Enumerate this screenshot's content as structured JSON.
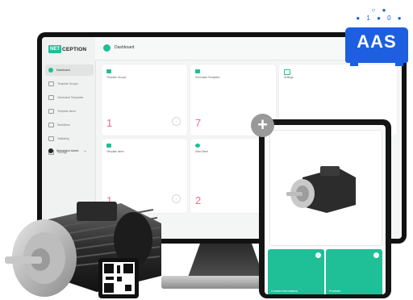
{
  "app": {
    "logo_mark": "NET",
    "logo_text": "CEPTION",
    "page_title": "Dashboard"
  },
  "sidebar": {
    "items": [
      {
        "label": "Dashboard",
        "active": true
      },
      {
        "label": "Template Groups",
        "active": false
      },
      {
        "label": "Generated Templates",
        "active": false
      },
      {
        "label": "Template Items",
        "active": false
      },
      {
        "label": "Workflows",
        "active": false
      },
      {
        "label": "Validating",
        "active": false
      },
      {
        "label": "Settings",
        "active": false
      }
    ],
    "user_name": "Nexception Admin"
  },
  "cards": [
    {
      "title": "Template Groups",
      "value": "1"
    },
    {
      "title": "Generated Templates",
      "value": "7"
    },
    {
      "title": "Settings",
      "value": ""
    },
    {
      "title": "Template Items",
      "value": "1"
    },
    {
      "title": "Data Sheet",
      "value": "2"
    }
  ],
  "tablet": {
    "tiles": [
      {
        "label": "Contact Informations"
      },
      {
        "label": "Products"
      }
    ]
  },
  "badge": {
    "text": "AAS",
    "bits_row1": "○ ●",
    "bits_row2": "● 1 ● 0 ●"
  },
  "colors": {
    "accent": "#1fbf97",
    "number": "#f26b8a",
    "badge": "#1d5fe0"
  }
}
